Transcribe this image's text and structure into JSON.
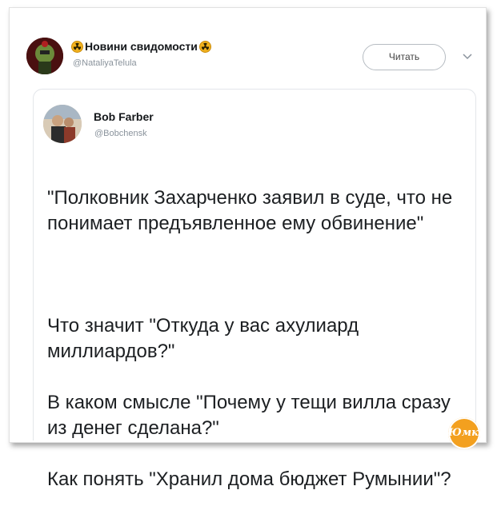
{
  "tweet": {
    "display_name": "Новини свидомости",
    "handle": "@NataliyaTelula",
    "follow_label": "Читать",
    "icon_left": "radiation-icon",
    "icon_right": "radiation-icon",
    "accent_color": "#f2b21e"
  },
  "quoted": {
    "display_name": "Bob Farber",
    "handle": "@Bobchensk",
    "lines": [
      "\"Полковник Захарченко заявил в суде, что не понимает предъявленное ему обвинение\"",
      "Что значит \"Откуда у вас ахулиард миллиардов?\"",
      "В каком смысле \"Почему у тещи вилла сразу из денег сделана?\"",
      "Как понять \"Хранил дома бюджет Румынии\"?"
    ]
  },
  "watermark": {
    "text": "Юмка"
  }
}
